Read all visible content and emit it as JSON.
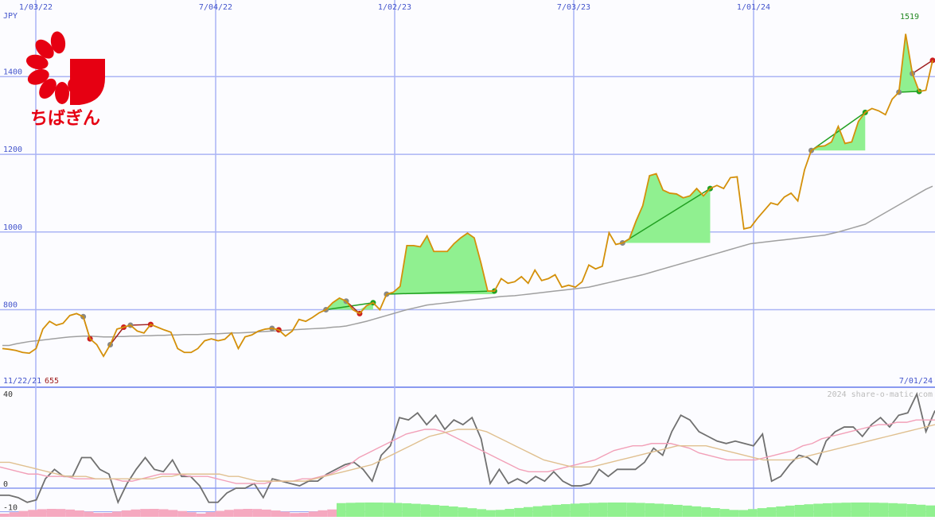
{
  "chart_data": [
    {
      "type": "line",
      "panel": "price",
      "currency_label": "JPY",
      "date_ticks": [
        "1/03/22",
        "7/04/22",
        "1/02/23",
        "7/03/23",
        "1/01/24"
      ],
      "y_ticks": [
        800,
        1000,
        1200,
        1400
      ],
      "ylim": [
        655,
        1519
      ],
      "grid": true,
      "max_label": "1519",
      "min_label": "655",
      "start_date_label": "11/22/21",
      "end_date_label": "7/01/24",
      "series": [
        {
          "values": [
            700,
            698,
            695,
            690,
            688,
            700,
            750,
            770,
            760,
            765,
            785,
            790,
            782,
            725,
            710,
            680,
            710,
            750,
            755,
            760,
            745,
            740,
            762,
            755,
            748,
            742,
            700,
            690,
            690,
            700,
            720,
            725,
            720,
            724,
            740,
            700,
            730,
            735,
            745,
            750,
            752,
            748,
            732,
            745,
            775,
            770,
            780,
            792,
            800,
            818,
            830,
            822,
            800,
            790,
            810,
            818,
            800,
            840,
            845,
            860,
            965,
            965,
            962,
            990,
            950,
            950,
            950,
            970,
            985,
            997,
            985,
            920,
            848,
            848,
            880,
            868,
            872,
            885,
            868,
            902,
            875,
            880,
            890,
            858,
            863,
            858,
            872,
            915,
            905,
            912,
            998,
            968,
            972,
            982,
            1028,
            1068,
            1145,
            1150,
            1108,
            1100,
            1098,
            1088,
            1093,
            1112,
            1093,
            1112,
            1120,
            1112,
            1140,
            1142,
            1008,
            1012,
            1035,
            1055,
            1075,
            1070,
            1090,
            1100,
            1080,
            1160,
            1210,
            1220,
            1222,
            1232,
            1272,
            1228,
            1232,
            1285,
            1308,
            1318,
            1312,
            1302,
            1342,
            1360,
            1510,
            1408,
            1362,
            1365,
            1442
          ]
        },
        {
          "values": [
            708,
            708,
            712,
            715,
            718,
            720,
            722,
            724,
            726,
            728,
            730,
            731,
            732,
            732,
            731,
            730,
            730,
            731,
            731,
            732,
            732,
            733,
            733,
            734,
            734,
            735,
            735,
            736,
            736,
            736,
            737,
            738,
            738,
            739,
            740,
            740,
            741,
            742,
            743,
            744,
            745,
            746,
            747,
            748,
            749,
            750,
            751,
            752,
            753,
            755,
            756,
            758,
            762,
            766,
            770,
            775,
            780,
            785,
            790,
            795,
            800,
            804,
            808,
            812,
            814,
            816,
            818,
            820,
            822,
            824,
            826,
            828,
            830,
            832,
            834,
            835,
            836,
            838,
            840,
            842,
            844,
            846,
            848,
            850,
            852,
            854,
            856,
            858,
            862,
            866,
            870,
            874,
            878,
            882,
            886,
            890,
            895,
            900,
            905,
            910,
            915,
            920,
            925,
            930,
            935,
            940,
            945,
            950,
            955,
            960,
            965,
            970,
            972,
            974,
            976,
            978,
            980,
            982,
            984,
            986,
            988,
            990,
            992,
            996,
            1000,
            1005,
            1010,
            1015,
            1020,
            1030,
            1040,
            1050,
            1060,
            1070,
            1080,
            1090,
            1100,
            1110,
            1118
          ]
        }
      ]
    },
    {
      "type": "line",
      "panel": "oscillator",
      "y_ticks": [
        40,
        0,
        -10
      ],
      "ylim": [
        -10,
        40
      ],
      "watermark": "2024 share-o-matic.com",
      "series": [
        {
          "values": [
            -3,
            -3,
            -4,
            -6,
            -5,
            4,
            8,
            5,
            5,
            13,
            13,
            8,
            6,
            -6,
            2,
            8,
            13,
            8,
            7,
            12,
            5,
            5,
            1,
            -6,
            -6,
            -2,
            0,
            0,
            2,
            -4,
            4,
            3,
            2,
            1,
            3,
            3,
            6,
            8,
            10,
            11,
            8,
            3,
            14,
            18,
            30,
            29,
            32,
            27,
            31,
            25,
            29,
            27,
            30,
            21,
            2,
            8,
            2,
            4,
            2,
            5,
            3,
            7,
            3,
            1,
            1,
            2,
            8,
            5,
            8,
            8,
            8,
            11,
            17,
            14,
            24,
            31,
            29,
            24,
            22,
            20,
            19,
            20,
            19,
            18,
            23,
            3,
            5,
            10,
            14,
            13,
            10,
            20,
            24,
            26,
            26,
            22,
            27,
            30,
            26,
            31,
            32,
            40,
            24,
            33
          ]
        },
        {
          "values": [
            9,
            8,
            7,
            6,
            6,
            5,
            5,
            5,
            4,
            4,
            4,
            4,
            4,
            3,
            3,
            4,
            5,
            6,
            6,
            6,
            5,
            5,
            5,
            4,
            3,
            2,
            2,
            2,
            2,
            3,
            3,
            3,
            4,
            4,
            5,
            6,
            8,
            10,
            13,
            15,
            17,
            19,
            21,
            23,
            24,
            25,
            25,
            24,
            22,
            20,
            18,
            16,
            14,
            12,
            10,
            8,
            7,
            7,
            7,
            8,
            9,
            10,
            11,
            12,
            14,
            16,
            17,
            18,
            18,
            19,
            19,
            19,
            18,
            17,
            15,
            14,
            13,
            12,
            12,
            12,
            12,
            13,
            14,
            15,
            16,
            18,
            19,
            21,
            22,
            23,
            24,
            25,
            26,
            27,
            27,
            28,
            28,
            29,
            29,
            29
          ]
        },
        {
          "values": [
            11,
            11,
            10,
            9,
            8,
            7,
            6,
            5,
            5,
            5,
            4,
            4,
            4,
            4,
            4,
            4,
            4,
            5,
            5,
            6,
            6,
            6,
            6,
            6,
            5,
            5,
            4,
            3,
            3,
            3,
            3,
            3,
            3,
            4,
            5,
            6,
            7,
            8,
            9,
            10,
            12,
            14,
            16,
            18,
            20,
            22,
            23,
            24,
            25,
            25,
            25,
            24,
            22,
            20,
            18,
            16,
            14,
            12,
            11,
            10,
            9,
            9,
            9,
            10,
            11,
            12,
            13,
            14,
            15,
            16,
            17,
            18,
            18,
            18,
            18,
            17,
            16,
            15,
            14,
            13,
            12,
            12,
            12,
            12,
            13,
            14,
            15,
            16,
            17,
            18,
            19,
            20,
            21,
            22,
            23,
            24,
            25,
            26,
            27
          ]
        }
      ]
    }
  ]
}
